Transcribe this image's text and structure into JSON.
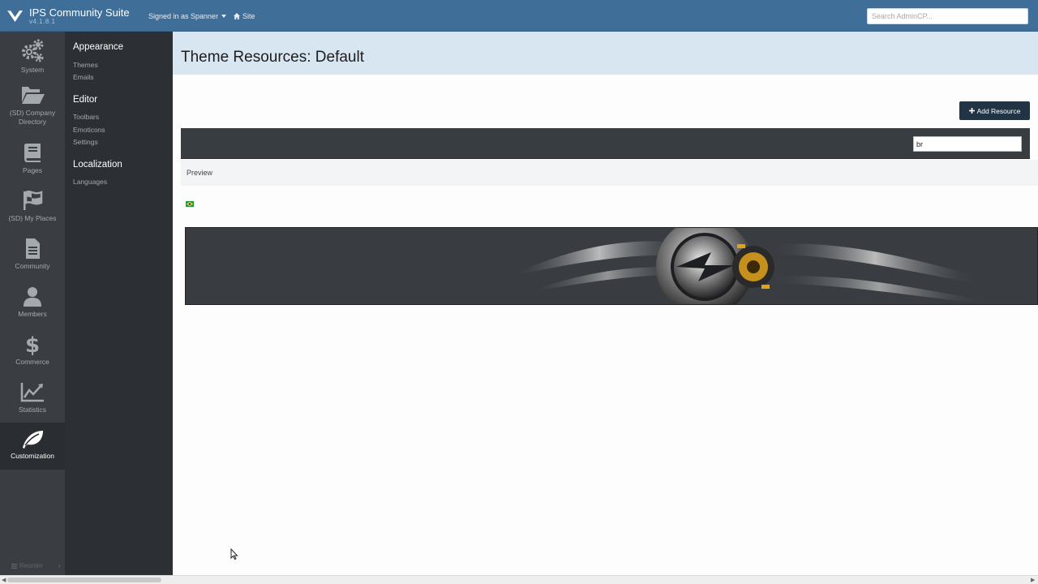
{
  "header": {
    "brand_title": "IPS Community Suite",
    "brand_version": "v4.1.8.1",
    "user_menu_label": "Signed in as Spanner",
    "site_link_label": "Site",
    "search_placeholder": "Search AdminCP..."
  },
  "icon_nav": {
    "items": [
      {
        "label": "System",
        "icon": "gears-icon"
      },
      {
        "label": "(SD) Company Directory",
        "icon": "folder-open-icon"
      },
      {
        "label": "Pages",
        "icon": "book-icon"
      },
      {
        "label": "(SD) My Places",
        "icon": "flag-icon"
      },
      {
        "label": "Community",
        "icon": "document-icon"
      },
      {
        "label": "Members",
        "icon": "user-icon"
      },
      {
        "label": "Commerce",
        "icon": "dollar-icon"
      },
      {
        "label": "Statistics",
        "icon": "line-chart-icon"
      },
      {
        "label": "Customization",
        "icon": "leaf-icon",
        "active": true
      }
    ]
  },
  "sub_nav": {
    "sections": [
      {
        "heading": "Appearance",
        "links": [
          "Themes",
          "Emails"
        ]
      },
      {
        "heading": "Editor",
        "links": [
          "Toolbars",
          "Emoticons",
          "Settings"
        ]
      },
      {
        "heading": "Localization",
        "links": [
          "Languages"
        ]
      }
    ],
    "reorder_label": "Reorder"
  },
  "main": {
    "page_title": "Theme Resources: Default",
    "add_button_label": "Add Resource",
    "filter_value": "br",
    "column_header": "Preview"
  },
  "colors": {
    "header_bg": "#3f6e99",
    "sidebar_bg": "#3a3e43",
    "subnav_bg": "#2c3035",
    "page_header_bg": "#d8e6f2",
    "button_bg": "#213446",
    "accent_gold": "#e0a21a"
  }
}
